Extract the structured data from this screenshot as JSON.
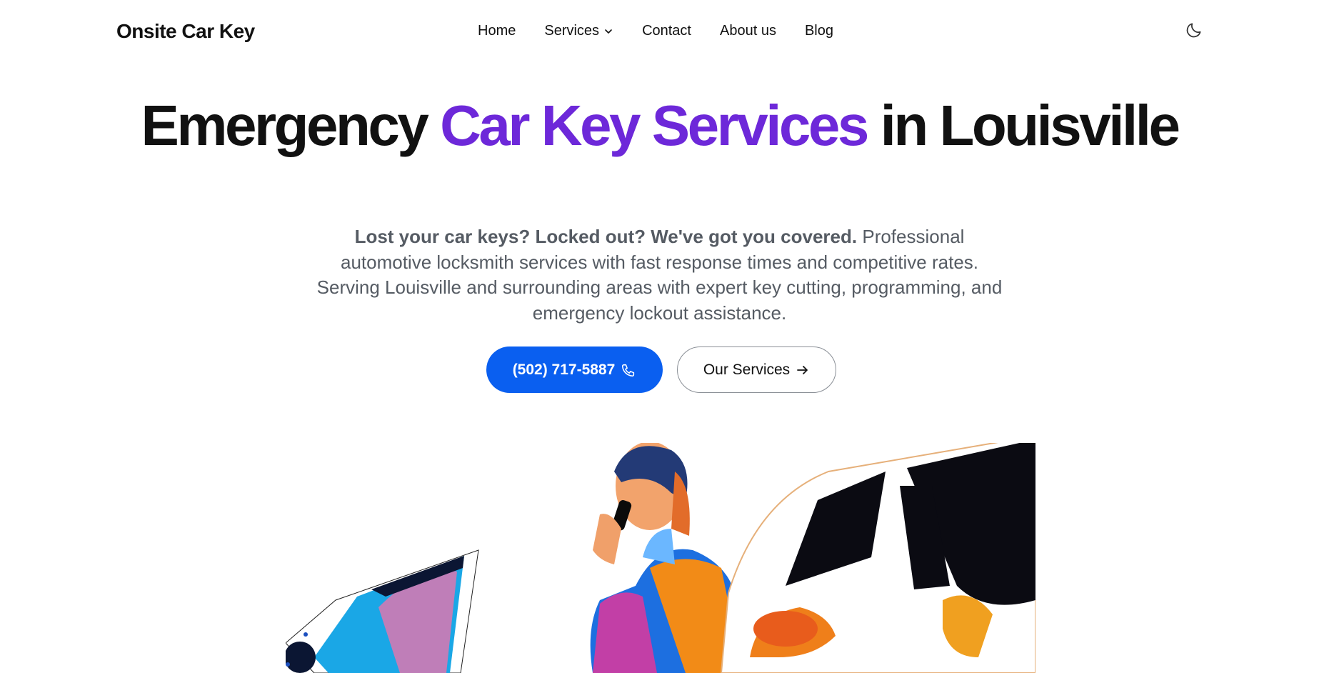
{
  "header": {
    "brand": "Onsite Car Key",
    "nav": [
      {
        "label": "Home"
      },
      {
        "label": "Services",
        "has_dropdown": true
      },
      {
        "label": "Contact"
      },
      {
        "label": "About us"
      },
      {
        "label": "Blog"
      }
    ],
    "theme_toggle_icon": "moon-icon"
  },
  "hero": {
    "title_part1": "Emergency ",
    "title_accent": "Car Key Services",
    "title_part2": " in Louisville",
    "subtitle_bold": "Lost your car keys? Locked out? We've got you covered.",
    "subtitle_rest": " Professional automotive locksmith services with fast response times and competitive rates. Serving Louisville and surrounding areas with expert key cutting, programming, and emergency lockout assistance.",
    "phone_button": "(502) 717-5887",
    "services_button": "Our Services"
  },
  "colors": {
    "accent": "#6d28d9",
    "primary_button": "#0a5ff0",
    "text": "#111111",
    "muted": "#555b63"
  },
  "icons": {
    "phone": "phone-icon",
    "arrow": "arrow-right-icon",
    "chevron": "chevron-down-icon"
  }
}
